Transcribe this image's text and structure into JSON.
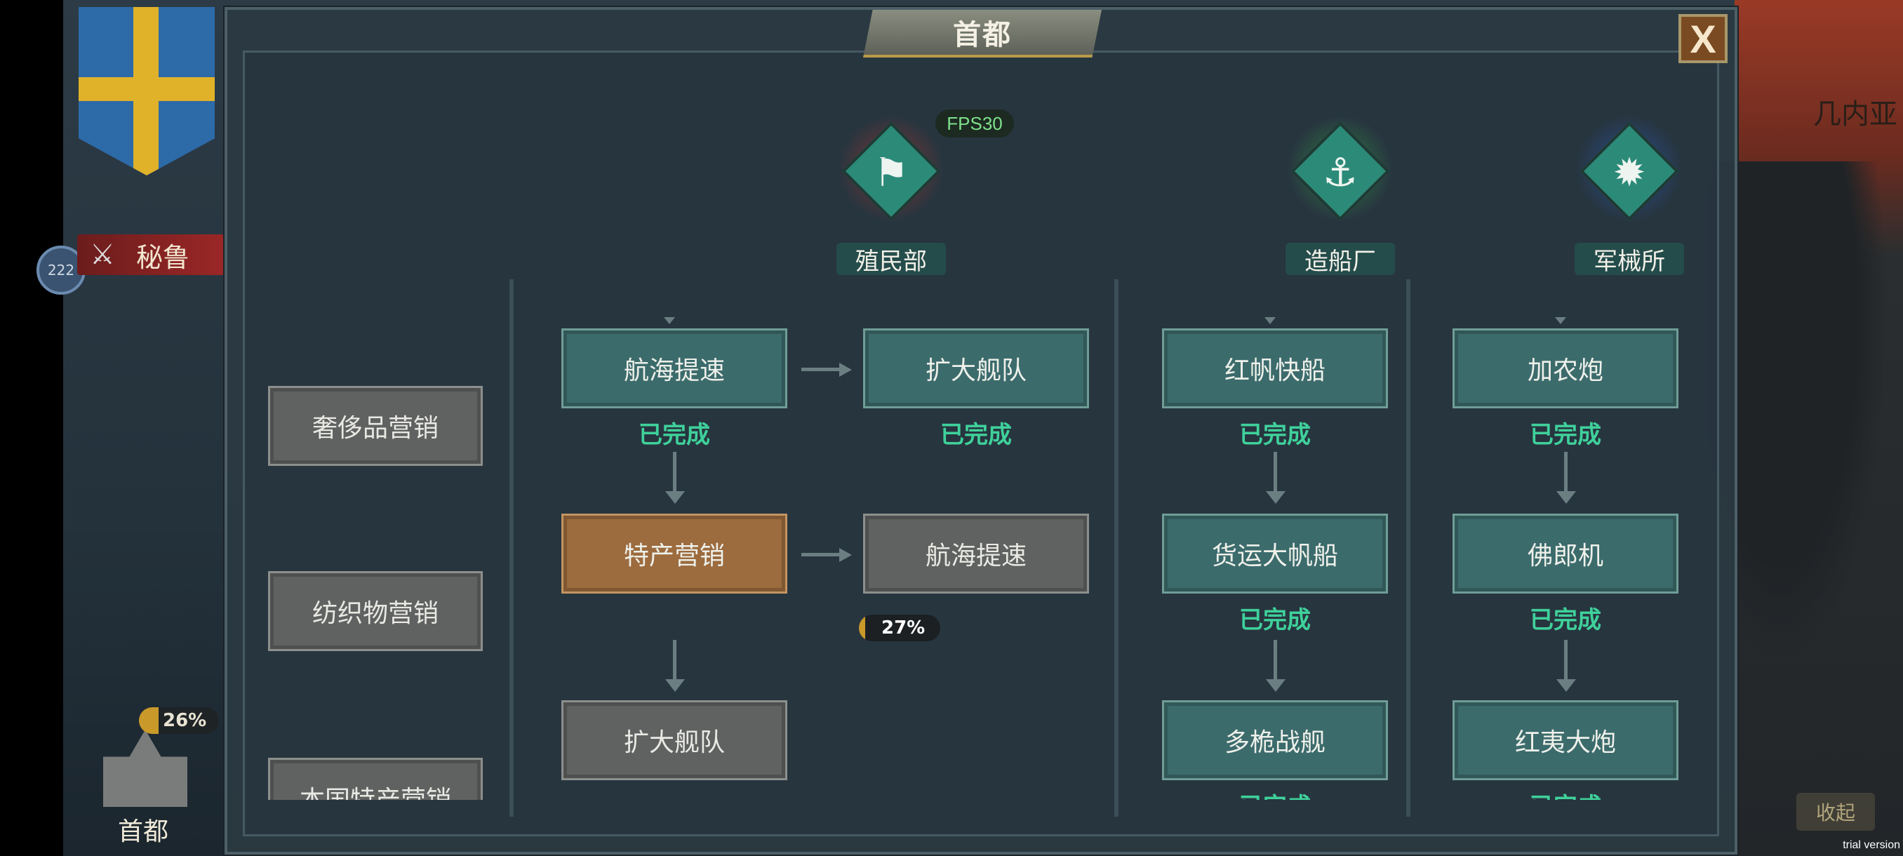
{
  "background": {
    "map_label": "几内亚",
    "collapse_label": "收起",
    "trial_label": "trial version",
    "enemy_name": "秘鲁",
    "level": "222",
    "capital_name": "首都",
    "capital_progress_label": "26%",
    "capital_progress": 0.26
  },
  "modal": {
    "title": "首都",
    "close_label": "X",
    "fps_label": "FPS30"
  },
  "departments": [
    {
      "name": "殖民部",
      "icon": "flag-icon",
      "glow": "#c8372e"
    },
    {
      "name": "造船厂",
      "icon": "shipyard-icon",
      "glow": "#3ab34a"
    },
    {
      "name": "军械所",
      "icon": "cannon-icon",
      "glow": "#2f62d6"
    }
  ],
  "left_column": [
    {
      "label": "奢侈品营销"
    },
    {
      "label": "纺织物营销"
    },
    {
      "label": "本国特产营销"
    }
  ],
  "colonial": {
    "col1": [
      {
        "label": "航海提速",
        "status": "已完成"
      },
      {
        "label": "特产营销",
        "progress_label": "27%",
        "progress": 0.27
      },
      {
        "label": "扩大舰队"
      }
    ],
    "col2": [
      {
        "label": "扩大舰队",
        "status": "已完成"
      },
      {
        "label": "航海提速"
      }
    ]
  },
  "shipyard": [
    {
      "label": "红帆快船",
      "status": "已完成"
    },
    {
      "label": "货运大帆船",
      "status": "已完成"
    },
    {
      "label": "多桅战舰",
      "status": "已完成"
    }
  ],
  "armory": [
    {
      "label": "加农炮",
      "status": "已完成"
    },
    {
      "label": "佛郎机",
      "status": "已完成"
    },
    {
      "label": "红夷大炮",
      "status": "已完成"
    }
  ]
}
